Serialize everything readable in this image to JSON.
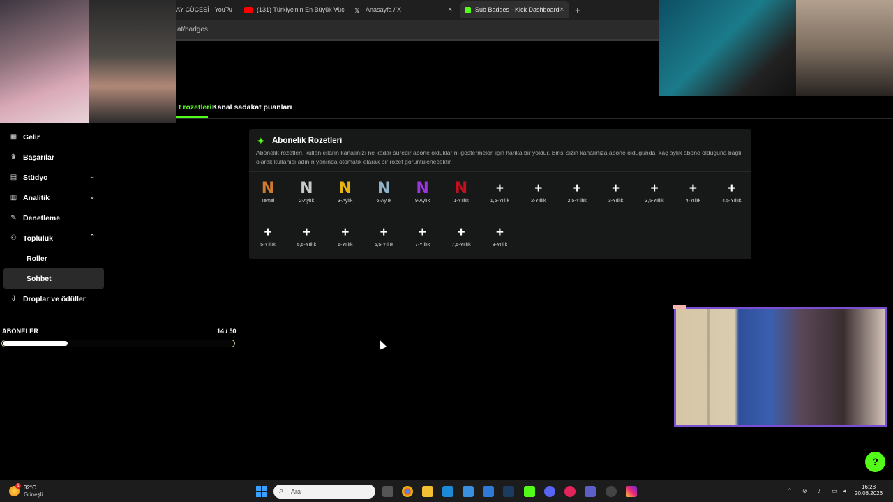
{
  "browser": {
    "tabs": [
      {
        "title": "AY CÜCESİ - YouTu",
        "fav": "#ff0000"
      },
      {
        "title": "(131) Türkiye'nin En Büyük Vüc",
        "fav": "#ff0000"
      },
      {
        "title": "Anasayfa / X",
        "fav": "#000000"
      },
      {
        "title": "Sub Badges - Kick Dashboard",
        "fav": "#53fc18"
      }
    ],
    "close_glyph": "×",
    "new_tab_glyph": "+",
    "address": "at/badges"
  },
  "page_tabs": {
    "active": "t rozetleri",
    "other": "Kanal sadakat puanları"
  },
  "sidebar": {
    "items": [
      {
        "label": "Gelir",
        "icon": "revenue-icon",
        "glyph": "▦"
      },
      {
        "label": "Başarılar",
        "icon": "trophy-icon",
        "glyph": "♛"
      },
      {
        "label": "Stüdyo",
        "icon": "studio-icon",
        "glyph": "▤",
        "chevron": "⌄"
      },
      {
        "label": "Analitik",
        "icon": "analytics-icon",
        "glyph": "▥",
        "chevron": "⌄"
      },
      {
        "label": "Denetleme",
        "icon": "wrench-icon",
        "glyph": "✎"
      },
      {
        "label": "Topluluk",
        "icon": "community-icon",
        "glyph": "⚇",
        "chevron": "⌃"
      }
    ],
    "sub_items": [
      "Roller",
      "Sohbet"
    ],
    "drops": {
      "label": "Droplar ve ödüller",
      "glyph": "⇩"
    }
  },
  "subscribers": {
    "label": "ABONELER",
    "count_text": "14 / 50",
    "current": 14,
    "goal": 50,
    "progress_fraction": 0.28
  },
  "panel": {
    "title": "Abonelik Rozetleri",
    "star": "✦",
    "description": "Abonelik rozetleri, kullanıcıların kanalınızı ne kadar süredir abone olduklarını göstermeleri için harika bir yoldur. Birisi sizin kanalınıza abone olduğunda, kaç aylık abone olduğuna bağlı olarak kullanıcı adının yanında otomatik olarak bir rozet görüntülenecektir.",
    "badges": [
      {
        "label": "Temel",
        "glyph": "N",
        "color": "#d07a2c"
      },
      {
        "label": "2-Aylık",
        "glyph": "N",
        "color": "#c9c9c9"
      },
      {
        "label": "3-Aylık",
        "glyph": "N",
        "color": "#e8b314"
      },
      {
        "label": "6-Aylık",
        "glyph": "N",
        "color": "#8fb3c7"
      },
      {
        "label": "9-Aylık",
        "glyph": "N",
        "color": "#9b35e0"
      },
      {
        "label": "1-Yıllık",
        "glyph": "N",
        "color": "#c4101e"
      },
      {
        "label": "1,5-Yıllık",
        "glyph": "+"
      },
      {
        "label": "2-Yıllık",
        "glyph": "+"
      },
      {
        "label": "2,5-Yıllık",
        "glyph": "+"
      },
      {
        "label": "3-Yıllık",
        "glyph": "+"
      },
      {
        "label": "3,5-Yıllık",
        "glyph": "+"
      },
      {
        "label": "4-Yıllık",
        "glyph": "+"
      },
      {
        "label": "4,5-Yıllık",
        "glyph": "+"
      },
      {
        "label": "5-Yıllık",
        "glyph": "+"
      },
      {
        "label": "5,5-Yıllık",
        "glyph": "+"
      },
      {
        "label": "6-Yıllık",
        "glyph": "+"
      },
      {
        "label": "6,5-Yıllık",
        "glyph": "+"
      },
      {
        "label": "7-Yıllık",
        "glyph": "+"
      },
      {
        "label": "7,5-Yıllık",
        "glyph": "+"
      },
      {
        "label": "8-Yıllık",
        "glyph": "+"
      }
    ]
  },
  "taskbar": {
    "weather_temp": "32°C",
    "weather_desc": "Güneşli",
    "weather_alert": "1",
    "search_placeholder": "Ara",
    "time": "16:28",
    "date": "20.08.2026",
    "tray_up": "⌃"
  },
  "colors": {
    "accent": "#53fc18",
    "cam_border": "#7b4fd1"
  },
  "help_glyph": "?"
}
